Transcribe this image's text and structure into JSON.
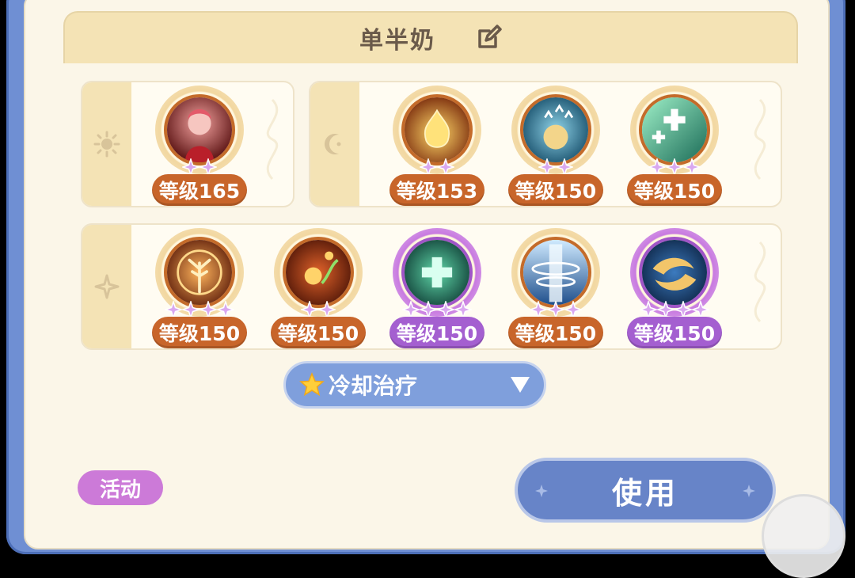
{
  "header": {
    "title": "单半奶",
    "edit_icon": "edit-icon"
  },
  "groups": [
    {
      "side_icon": "sun-icon",
      "skills": [
        {
          "level": "等级165",
          "stars": 2,
          "theme": "orange",
          "icon": "girl-portrait-icon"
        }
      ]
    },
    {
      "side_icon": "moon-icon",
      "skills": [
        {
          "level": "等级153",
          "stars": 2,
          "theme": "orange",
          "icon": "golden-flame-icon"
        },
        {
          "level": "等级150",
          "stars": 2,
          "theme": "orange",
          "icon": "speed-up-orb-icon"
        },
        {
          "level": "等级150",
          "stars": 3,
          "theme": "orange",
          "icon": "heal-cross-icon"
        }
      ]
    },
    {
      "side_icon": "sparkle-icon",
      "skills": [
        {
          "level": "等级150",
          "stars": 4,
          "theme": "orange",
          "icon": "tree-of-life-icon"
        },
        {
          "level": "等级150",
          "stars": 2,
          "theme": "orange",
          "icon": "flower-vine-icon"
        },
        {
          "level": "等级150",
          "stars": 4,
          "theme": "purple",
          "icon": "green-cross-icon"
        },
        {
          "level": "等级150",
          "stars": 3,
          "theme": "orange",
          "icon": "light-pillar-icon"
        },
        {
          "level": "等级150",
          "stars": 4,
          "theme": "purple",
          "icon": "golden-fish-icon"
        }
      ]
    }
  ],
  "preset_select": {
    "selected": "冷却治疗",
    "icon": "star-icon"
  },
  "activity_badge": "活动",
  "use_button": "使用",
  "colors": {
    "frame": "#6f8fd3",
    "panel": "#fbf6e8",
    "level_orange": "#c8652a",
    "level_purple": "#a45fd0",
    "use_button": "#6784c8"
  }
}
